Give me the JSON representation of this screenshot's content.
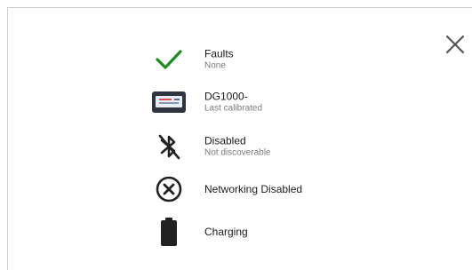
{
  "close": {
    "icon": "close-icon"
  },
  "status_items": [
    {
      "icon": "checkmark-icon",
      "color": "#1f8a1f",
      "title": "Faults",
      "subtitle": "None"
    },
    {
      "icon": "device-icon",
      "title": "DG1000-",
      "subtitle": "Last calibrated"
    },
    {
      "icon": "bluetooth-disabled-icon",
      "title": "Disabled",
      "subtitle": "Not discoverable"
    },
    {
      "icon": "networking-disabled-icon",
      "title": "Networking Disabled"
    },
    {
      "icon": "battery-icon",
      "title": "Charging"
    }
  ],
  "colors": {
    "check": "#1f8a1f",
    "icon_dark": "#222222",
    "device_screen": "#e9edf6",
    "device_accent": "#d9534f"
  }
}
